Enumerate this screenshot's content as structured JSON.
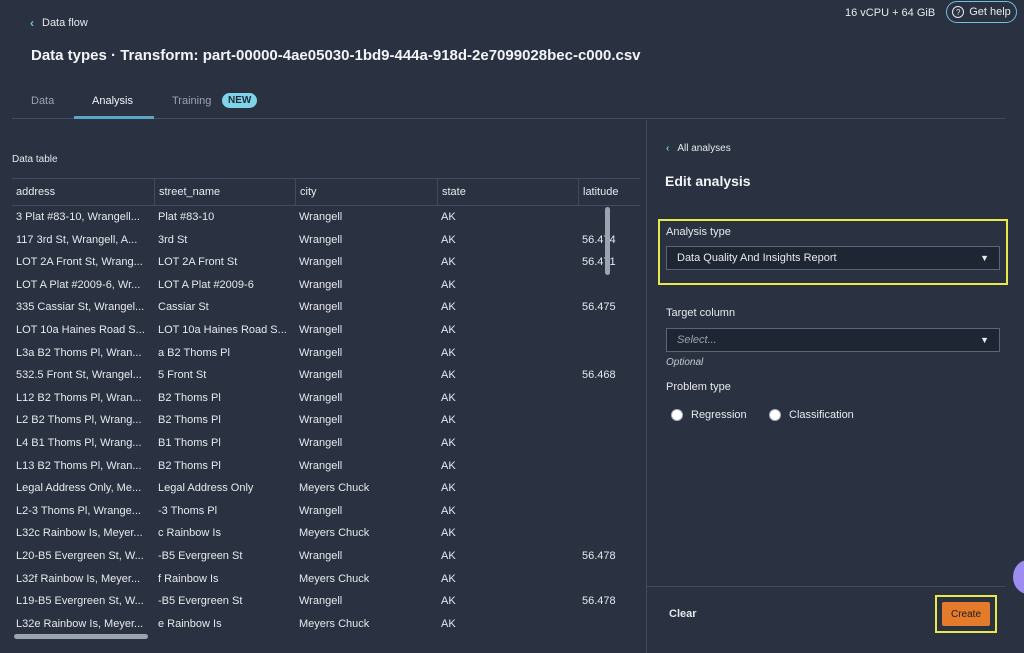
{
  "header": {
    "back_label": "Data flow",
    "resources": "16 vCPU + 64 GiB",
    "help_label": "Get help",
    "title": "Data types · Transform: part-00000-4ae05030-1bd9-444a-918d-2e7099028bec-c000.csv"
  },
  "tabs": [
    {
      "label": "Data"
    },
    {
      "label": "Analysis"
    },
    {
      "label": "Training"
    }
  ],
  "tab_badge": "NEW",
  "data_table": {
    "title": "Data table",
    "columns": [
      "address",
      "street_name",
      "city",
      "state",
      "latitude"
    ],
    "rows": [
      [
        "3 Plat #83-10, Wrangell...",
        "Plat #83-10",
        "Wrangell",
        "AK",
        ""
      ],
      [
        "117 3rd St, Wrangell, A...",
        "3rd St",
        "Wrangell",
        "AK",
        "56.474"
      ],
      [
        "LOT 2A Front St, Wrang...",
        "LOT 2A Front St",
        "Wrangell",
        "AK",
        "56.471"
      ],
      [
        "LOT A Plat #2009-6, Wr...",
        "LOT A Plat #2009-6",
        "Wrangell",
        "AK",
        ""
      ],
      [
        "335 Cassiar St, Wrangel...",
        "Cassiar St",
        "Wrangell",
        "AK",
        "56.475"
      ],
      [
        "LOT 10a Haines Road S...",
        "LOT 10a Haines Road S...",
        "Wrangell",
        "AK",
        ""
      ],
      [
        "L3a B2 Thoms Pl, Wran...",
        "a B2 Thoms Pl",
        "Wrangell",
        "AK",
        ""
      ],
      [
        "532.5 Front St, Wrangel...",
        "5 Front St",
        "Wrangell",
        "AK",
        "56.468"
      ],
      [
        "L12 B2 Thoms Pl, Wran...",
        "B2 Thoms Pl",
        "Wrangell",
        "AK",
        ""
      ],
      [
        "L2 B2 Thoms Pl, Wrang...",
        "B2 Thoms Pl",
        "Wrangell",
        "AK",
        ""
      ],
      [
        "L4 B1 Thoms Pl, Wrang...",
        "B1 Thoms Pl",
        "Wrangell",
        "AK",
        ""
      ],
      [
        "L13 B2 Thoms Pl, Wran...",
        "B2 Thoms Pl",
        "Wrangell",
        "AK",
        ""
      ],
      [
        "Legal Address Only, Me...",
        "Legal Address Only",
        "Meyers Chuck",
        "AK",
        ""
      ],
      [
        "L2-3 Thoms Pl, Wrange...",
        "-3 Thoms Pl",
        "Wrangell",
        "AK",
        ""
      ],
      [
        "L32c Rainbow Is, Meyer...",
        "c Rainbow Is",
        "Meyers Chuck",
        "AK",
        ""
      ],
      [
        "L20-B5 Evergreen St, W...",
        "-B5 Evergreen St",
        "Wrangell",
        "AK",
        "56.478"
      ],
      [
        "L32f Rainbow Is, Meyer...",
        "f Rainbow Is",
        "Meyers Chuck",
        "AK",
        ""
      ],
      [
        "L19-B5 Evergreen St, W...",
        "-B5 Evergreen St",
        "Wrangell",
        "AK",
        "56.478"
      ],
      [
        "L32e Rainbow Is, Meyer...",
        "e Rainbow Is",
        "Meyers Chuck",
        "AK",
        ""
      ]
    ]
  },
  "edit_panel": {
    "back_label": "All analyses",
    "title": "Edit analysis",
    "analysis_type_label": "Analysis type",
    "analysis_type_value": "Data Quality And Insights Report",
    "target_column_label": "Target column",
    "target_column_placeholder": "Select...",
    "optional_label": "Optional",
    "problem_type_label": "Problem type",
    "problem_types": [
      "Regression",
      "Classification"
    ],
    "clear_label": "Clear",
    "create_label": "Create"
  },
  "colors": {
    "background": "#2a3140",
    "accent": "#6fc3df",
    "highlight": "#e8e84a",
    "primary_button": "#e37b2a"
  }
}
